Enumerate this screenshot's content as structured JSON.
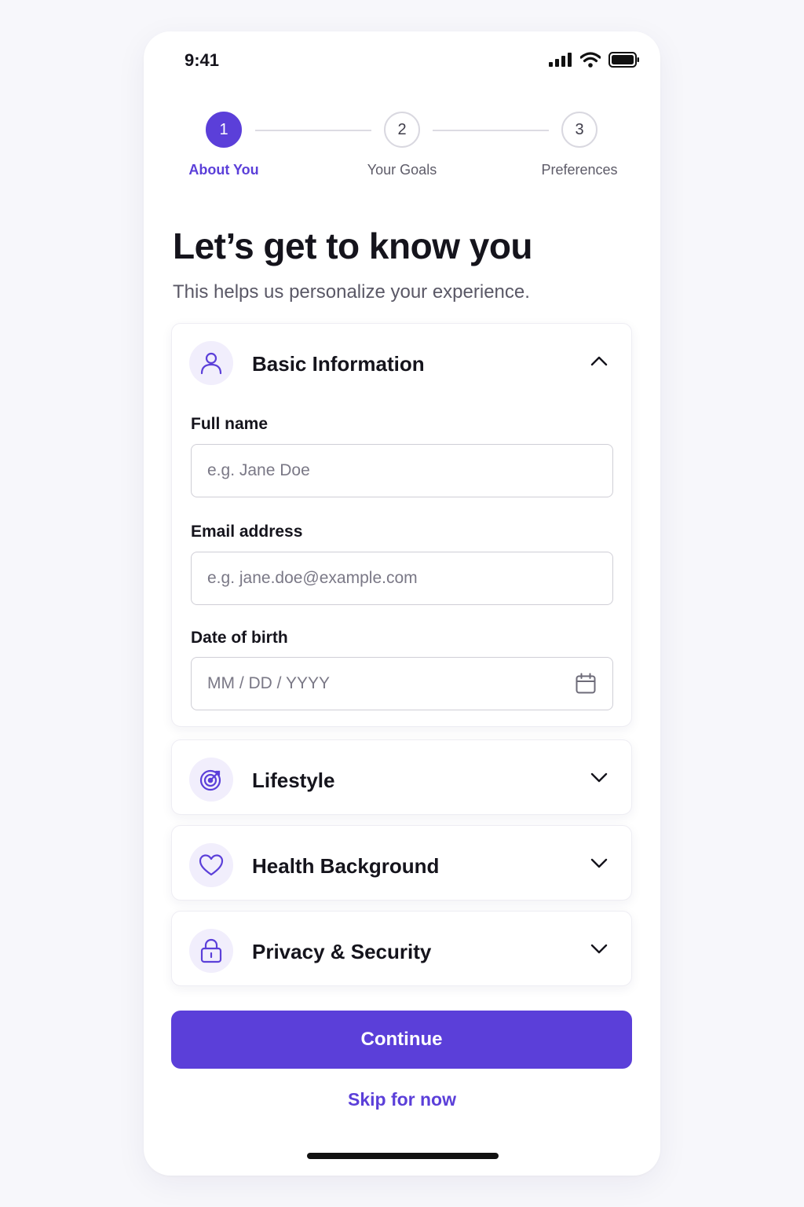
{
  "status_bar": {
    "time": "9:41"
  },
  "stepper": {
    "steps": [
      {
        "number": "1",
        "label": "About You"
      },
      {
        "number": "2",
        "label": "Your Goals"
      },
      {
        "number": "3",
        "label": "Preferences"
      }
    ],
    "active_step": 1
  },
  "header": {
    "title": "Let’s get to know you",
    "subtitle": "This helps us personalize your experience."
  },
  "sections": {
    "basic_info": {
      "title": "Basic Information",
      "icon": "user-icon",
      "expanded": true,
      "fields": {
        "full_name": {
          "label": "Full name",
          "placeholder": "e.g. Jane Doe",
          "value": ""
        },
        "email": {
          "label": "Email address",
          "placeholder": "e.g. jane.doe@example.com",
          "value": ""
        },
        "dob": {
          "label": "Date of birth",
          "placeholder": "MM / DD / YYYY",
          "value": ""
        }
      }
    },
    "lifestyle": {
      "title": "Lifestyle",
      "icon": "target-icon",
      "expanded": false
    },
    "health": {
      "title": "Health Background",
      "icon": "heart-icon",
      "expanded": false
    },
    "privacy": {
      "title": "Privacy & Security",
      "icon": "lock-icon",
      "expanded": false
    }
  },
  "actions": {
    "continue_label": "Continue",
    "skip_label": "Skip for now"
  },
  "colors": {
    "accent": "#5b3fd9",
    "icon_bg": "#f1eefc",
    "page_bg": "#f7f7fb"
  }
}
